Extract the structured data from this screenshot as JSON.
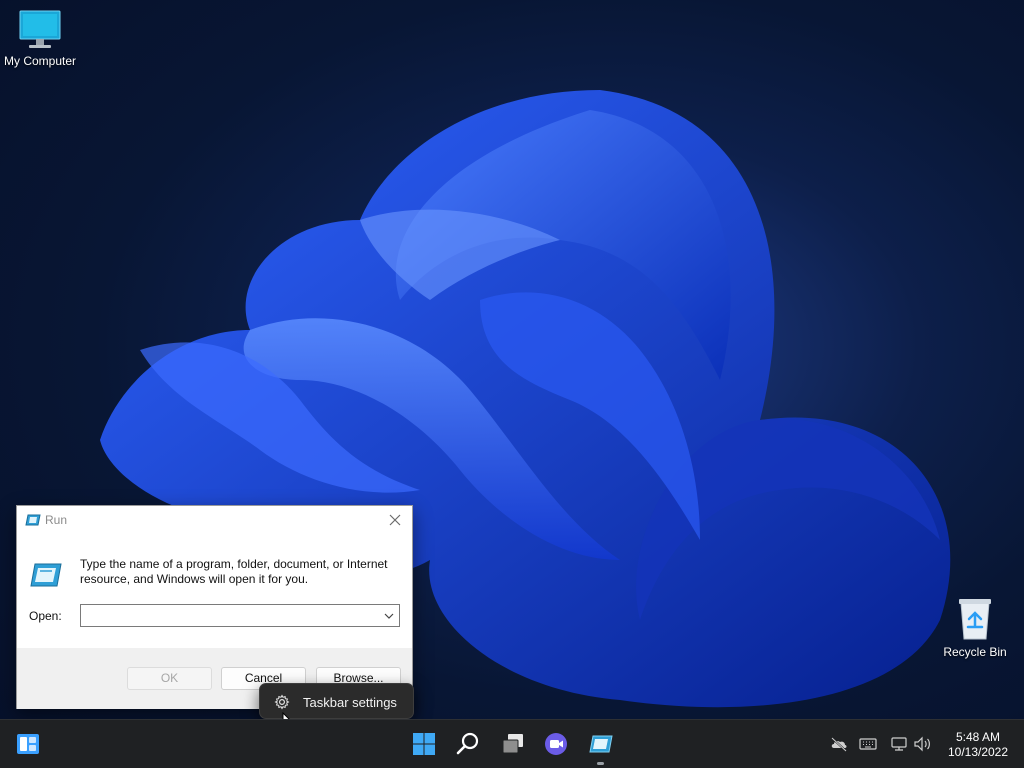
{
  "desktop": {
    "icons": [
      {
        "label": "My Computer",
        "icon": "computer-icon"
      },
      {
        "label": "Recycle Bin",
        "icon": "recycle-bin-icon"
      }
    ]
  },
  "run_dialog": {
    "title": "Run",
    "description": "Type the name of a program, folder, document, or Internet resource, and Windows will open it for you.",
    "open_label": "Open:",
    "open_value": "",
    "buttons": {
      "ok": "OK",
      "cancel": "Cancel",
      "browse": "Browse..."
    }
  },
  "context_menu": {
    "items": [
      {
        "label": "Taskbar settings",
        "icon": "gear-icon"
      }
    ]
  },
  "taskbar": {
    "apps": [
      "widgets-icon",
      "start-icon",
      "search-icon",
      "task-view-icon",
      "meet-icon",
      "run-app-icon"
    ],
    "tray": [
      "cloud-offline-icon",
      "keyboard-icon",
      "network-icon",
      "volume-icon"
    ],
    "clock": {
      "time": "5:48 AM",
      "date": "10/13/2022"
    }
  },
  "colors": {
    "accent": "#1e90ff",
    "taskbar": "#1f2123",
    "menu": "#2b2b2b"
  }
}
